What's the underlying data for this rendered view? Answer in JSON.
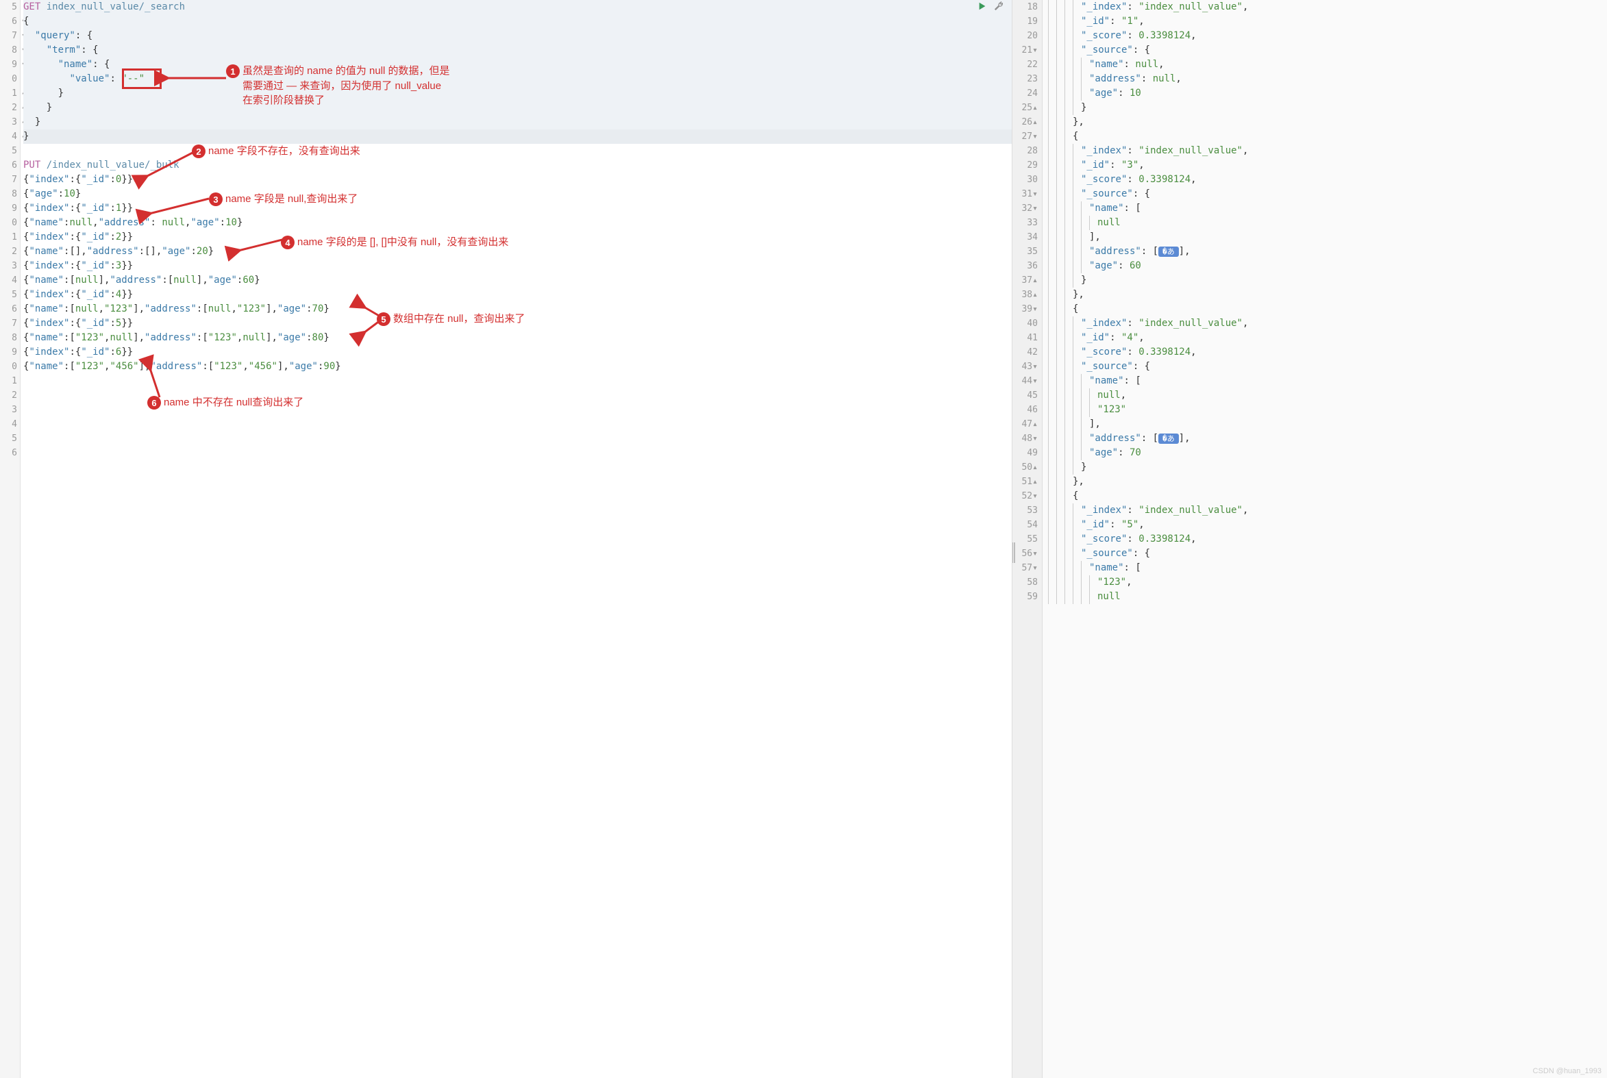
{
  "left": {
    "toolbar": {
      "run": "▶",
      "wrench": "🔧"
    },
    "lines_start": 5,
    "get": {
      "method": "GET",
      "path": "index_null_value/_search",
      "body_open": "{",
      "query_key": "\"query\"",
      "term_key": "\"term\"",
      "name_key": "\"name\"",
      "value_key": "\"value\"",
      "value_val": "\"--\""
    },
    "put": {
      "method": "PUT",
      "path": "/index_null_value/_bulk",
      "rows": [
        "{\"index\":{\"_id\":0}}",
        "{\"age\":10}",
        "{\"index\":{\"_id\":1}}",
        "{\"name\":null,\"address\": null,\"age\":10}",
        "{\"index\":{\"_id\":2}}",
        "{\"name\":[],\"address\":[],\"age\":20}",
        "{\"index\":{\"_id\":3}}",
        "{\"name\":[null],\"address\":[null],\"age\":60}",
        "{\"index\":{\"_id\":4}}",
        "{\"name\":[null,\"123\"],\"address\":[null,\"123\"],\"age\":70}",
        "{\"index\":{\"_id\":5}}",
        "{\"name\":[\"123\",null],\"address\":[\"123\",null],\"age\":80}",
        "{\"index\":{\"_id\":6}}",
        "{\"name\":[\"123\",\"456\"],\"address\":[\"123\",\"456\"],\"age\":90}"
      ]
    },
    "annotations": {
      "a1": {
        "num": "1",
        "text1": "虽然是查询的 name 的值为 null 的数据，但是",
        "text2": "需要通过 — 来查询，因为使用了 null_value",
        "text3": "在索引阶段替换了"
      },
      "a2": {
        "num": "2",
        "text": "name 字段不存在，没有查询出来"
      },
      "a3": {
        "num": "3",
        "text": "name 字段是 null,查询出来了"
      },
      "a4": {
        "num": "4",
        "text": "name 字段的是 [], []中没有 null，没有查询出来"
      },
      "a5": {
        "num": "5",
        "text": "数组中存在 null，查询出来了"
      },
      "a6": {
        "num": "6",
        "text": "name 中不存在 null查询出来了"
      }
    }
  },
  "right": {
    "lines_start": 18,
    "hits": [
      {
        "partial_top": true,
        "index": "\"index_null_value\"",
        "id": "\"1\"",
        "score": "0.3398124",
        "source": {
          "name": "null",
          "address": "null",
          "age": "10"
        }
      },
      {
        "index": "\"index_null_value\"",
        "id": "\"3\"",
        "score": "0.3398124",
        "source": {
          "name_arr": [
            "null"
          ],
          "address_collapsed": true,
          "age": "60"
        }
      },
      {
        "index": "\"index_null_value\"",
        "id": "\"4\"",
        "score": "0.3398124",
        "source": {
          "name_arr": [
            "null",
            "\"123\""
          ],
          "address_collapsed": true,
          "age": "70"
        }
      },
      {
        "partial_bottom": true,
        "index": "\"index_null_value\"",
        "id": "\"5\"",
        "score": "0.3398124",
        "source": {
          "name_arr_open": true,
          "name_arr": [
            "\"123\""
          ]
        }
      }
    ]
  },
  "watermark": "CSDN @huan_1993"
}
